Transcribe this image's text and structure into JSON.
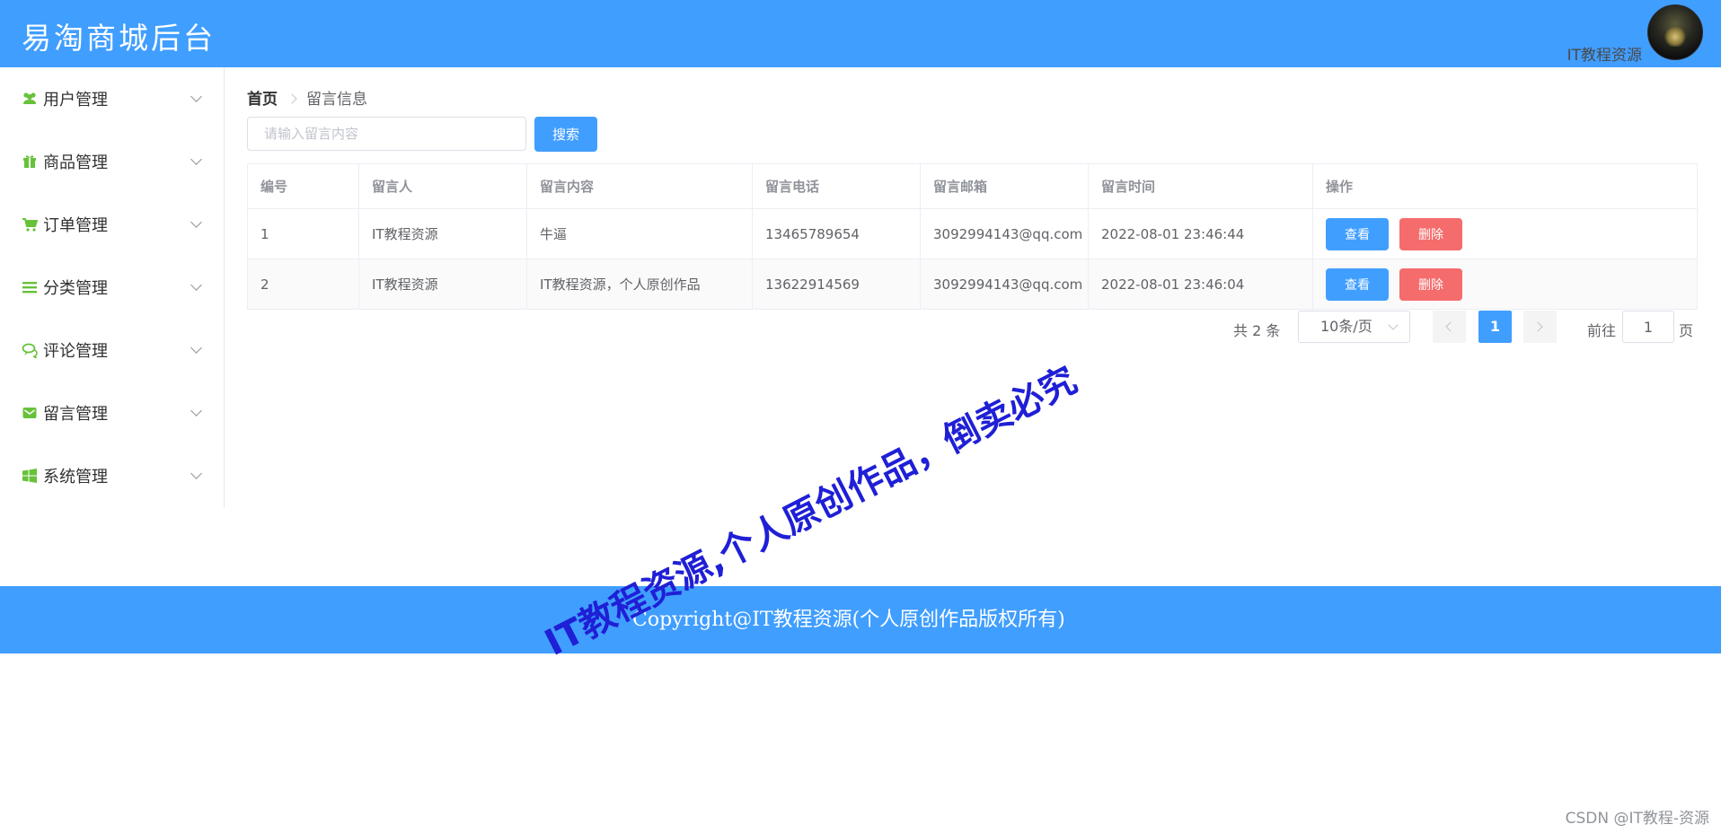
{
  "header": {
    "brand": "易淘商城后台",
    "user_name": "IT教程资源"
  },
  "sidebar": {
    "items": [
      {
        "label": "用户管理",
        "icon": "users-icon"
      },
      {
        "label": "商品管理",
        "icon": "gift-icon"
      },
      {
        "label": "订单管理",
        "icon": "cart-icon"
      },
      {
        "label": "分类管理",
        "icon": "list-icon"
      },
      {
        "label": "评论管理",
        "icon": "comments-icon"
      },
      {
        "label": "留言管理",
        "icon": "envelope-icon"
      },
      {
        "label": "系统管理",
        "icon": "windows-icon"
      }
    ]
  },
  "breadcrumb": {
    "home": "首页",
    "current": "留言信息"
  },
  "search": {
    "placeholder": "请输入留言内容",
    "value": "",
    "button_label": "搜索"
  },
  "table": {
    "headers": [
      "编号",
      "留言人",
      "留言内容",
      "留言电话",
      "留言邮箱",
      "留言时间",
      "操作"
    ],
    "rows": [
      {
        "id": "1",
        "name": "IT教程资源",
        "content": "牛逼",
        "phone": "13465789654",
        "email": "3092994143@qq.com",
        "time": "2022-08-01 23:46:44"
      },
      {
        "id": "2",
        "name": "IT教程资源",
        "content": "IT教程资源，个人原创作品",
        "phone": "13622914569",
        "email": "3092994143@qq.com",
        "time": "2022-08-01 23:46:04"
      }
    ],
    "view_label": "查看",
    "delete_label": "删除"
  },
  "pagination": {
    "total": "共 2 条",
    "page_size": "10条/页",
    "current_page": "1",
    "goto_label": "前往",
    "goto_value": "1",
    "page_label": "页"
  },
  "footer": {
    "copyright": "Copyright@IT教程资源(个人原创作品版权所有)"
  },
  "watermark": "IT教程资源,个人原创作品，倒卖必究",
  "csdn_mark": "CSDN @IT教程-资源",
  "colors": {
    "primary": "#409eff",
    "danger": "#f56c6c",
    "menu_icon": "#67c23a",
    "watermark": "#1f1fd6"
  }
}
